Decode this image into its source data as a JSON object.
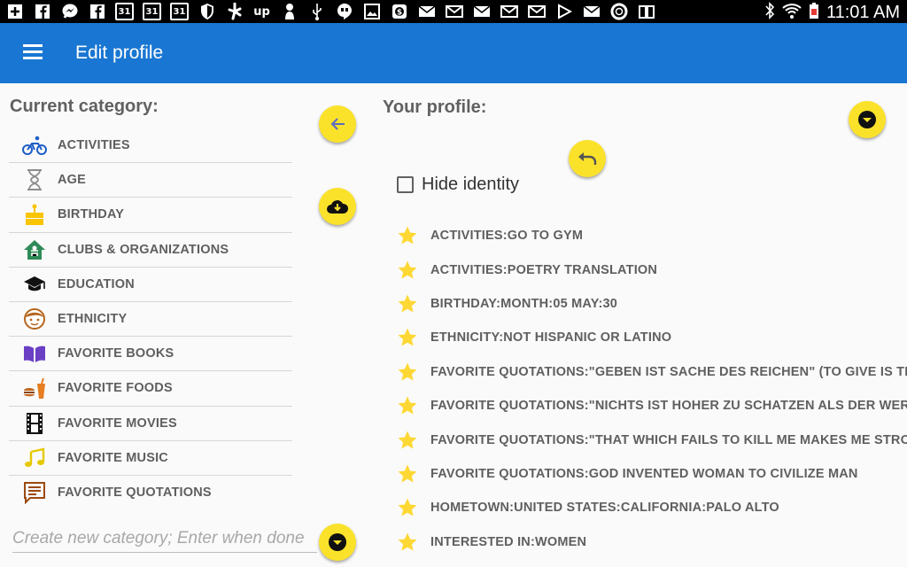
{
  "status_bar": {
    "time": "11:01 AM",
    "left_icons": [
      "add-icon",
      "facebook-icon",
      "messenger-icon",
      "facebook-icon",
      "calendar-icon",
      "calendar-icon",
      "calendar-icon",
      "shield-icon",
      "yelp-icon",
      "upwork-icon",
      "person-icon",
      "usb-icon",
      "hangouts-icon",
      "photo-icon",
      "dollar-icon",
      "mail-icon",
      "mail-icon",
      "mail-icon",
      "mail-icon",
      "mail-icon",
      "play-icon",
      "mail-icon",
      "lifebuoy-icon",
      "book-icon"
    ],
    "calendar_day": "31",
    "upwork_text": "up"
  },
  "app_bar": {
    "title": "Edit profile",
    "color": "#1976d2"
  },
  "left_panel": {
    "title": "Current category:",
    "categories": [
      {
        "label": "ACTIVITIES",
        "icon": "bicycle-icon"
      },
      {
        "label": "AGE",
        "icon": "hourglass-icon"
      },
      {
        "label": "BIRTHDAY",
        "icon": "cake-icon"
      },
      {
        "label": "CLUBS & ORGANIZATIONS",
        "icon": "clubhouse-icon"
      },
      {
        "label": "EDUCATION",
        "icon": "graduation-cap-icon"
      },
      {
        "label": "ETHNICITY",
        "icon": "face-icon"
      },
      {
        "label": "FAVORITE BOOKS",
        "icon": "book-icon"
      },
      {
        "label": "FAVORITE FOODS",
        "icon": "food-icon"
      },
      {
        "label": "FAVORITE MOVIES",
        "icon": "film-icon"
      },
      {
        "label": "FAVORITE MUSIC",
        "icon": "music-note-icon"
      },
      {
        "label": "FAVORITE QUOTATIONS",
        "icon": "quote-icon"
      }
    ],
    "new_category_placeholder": "Create new category; Enter when done"
  },
  "right_panel": {
    "title": "Your profile:",
    "hide_identity_label": "Hide identity",
    "hide_identity_checked": false,
    "items": [
      "ACTIVITIES:GO TO GYM",
      "ACTIVITIES:POETRY TRANSLATION",
      "BIRTHDAY:MONTH:05 MAY:30",
      "ETHNICITY:NOT HISPANIC OR LATINO",
      "FAVORITE QUOTATIONS:\"GEBEN IST SACHE DES REICHEN\" (TO GIVE IS THE",
      "FAVORITE QUOTATIONS:\"NICHTS IST HOHER ZU SCHATZEN ALS DER WERT",
      "FAVORITE QUOTATIONS:\"THAT WHICH FAILS TO KILL ME MAKES ME STRON",
      "FAVORITE QUOTATIONS:GOD INVENTED WOMAN TO CIVILIZE MAN",
      "HOMETOWN:UNITED STATES:CALIFORNIA:PALO ALTO",
      "INTERESTED IN:WOMEN"
    ]
  },
  "colors": {
    "fab": "#fbe22a",
    "star": "#fdd835",
    "text": "#5f5f5f"
  }
}
